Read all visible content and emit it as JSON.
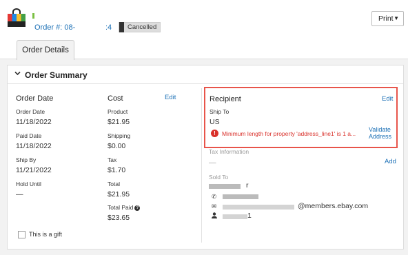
{
  "header": {
    "order_label": "Order #: 08-",
    "order_suffix": ":4",
    "status": "Cancelled",
    "print_label": "Print"
  },
  "tabs": {
    "order_details": "Order Details"
  },
  "summary": {
    "title": "Order Summary",
    "order_date": {
      "heading": "Order Date",
      "order_date_label": "Order Date",
      "order_date_value": "11/18/2022",
      "paid_date_label": "Paid Date",
      "paid_date_value": "11/18/2022",
      "ship_by_label": "Ship By",
      "ship_by_value": "11/21/2022",
      "hold_until_label": "Hold Until",
      "hold_until_value": "—"
    },
    "cost": {
      "heading": "Cost",
      "edit_label": "Edit",
      "product_label": "Product",
      "product_value": "$21.95",
      "shipping_label": "Shipping",
      "shipping_value": "$0.00",
      "tax_label": "Tax",
      "tax_value": "$1.70",
      "total_label": "Total",
      "total_value": "$21.95",
      "total_paid_label": "Total Paid",
      "total_paid_value": "$23.65"
    },
    "gift_label": "This is a gift",
    "recipient": {
      "heading": "Recipient",
      "edit_label": "Edit",
      "ship_to_label": "Ship To",
      "ship_to_value": "US",
      "error_text": "Minimum length for property 'address_line1' is 1 a...",
      "validate_label": "Validate",
      "address_label": "Address"
    },
    "tax_info": {
      "heading": "Tax Information",
      "value": "—",
      "add_label": "Add"
    },
    "sold_to": {
      "heading": "Sold To",
      "name_fragment": "r",
      "email_fragment": "@members.ebay.com",
      "username_fragment": "1"
    }
  },
  "icons": {
    "chevron": "chevron-down-icon",
    "error": "error-icon",
    "info": "info-icon",
    "phone": "phone-icon",
    "email": "envelope-icon",
    "user": "user-icon"
  },
  "colors": {
    "link": "#1a6fb5",
    "error": "#d9302a",
    "highlight_border": "#e8544a",
    "badge_bg": "#dddddd"
  }
}
